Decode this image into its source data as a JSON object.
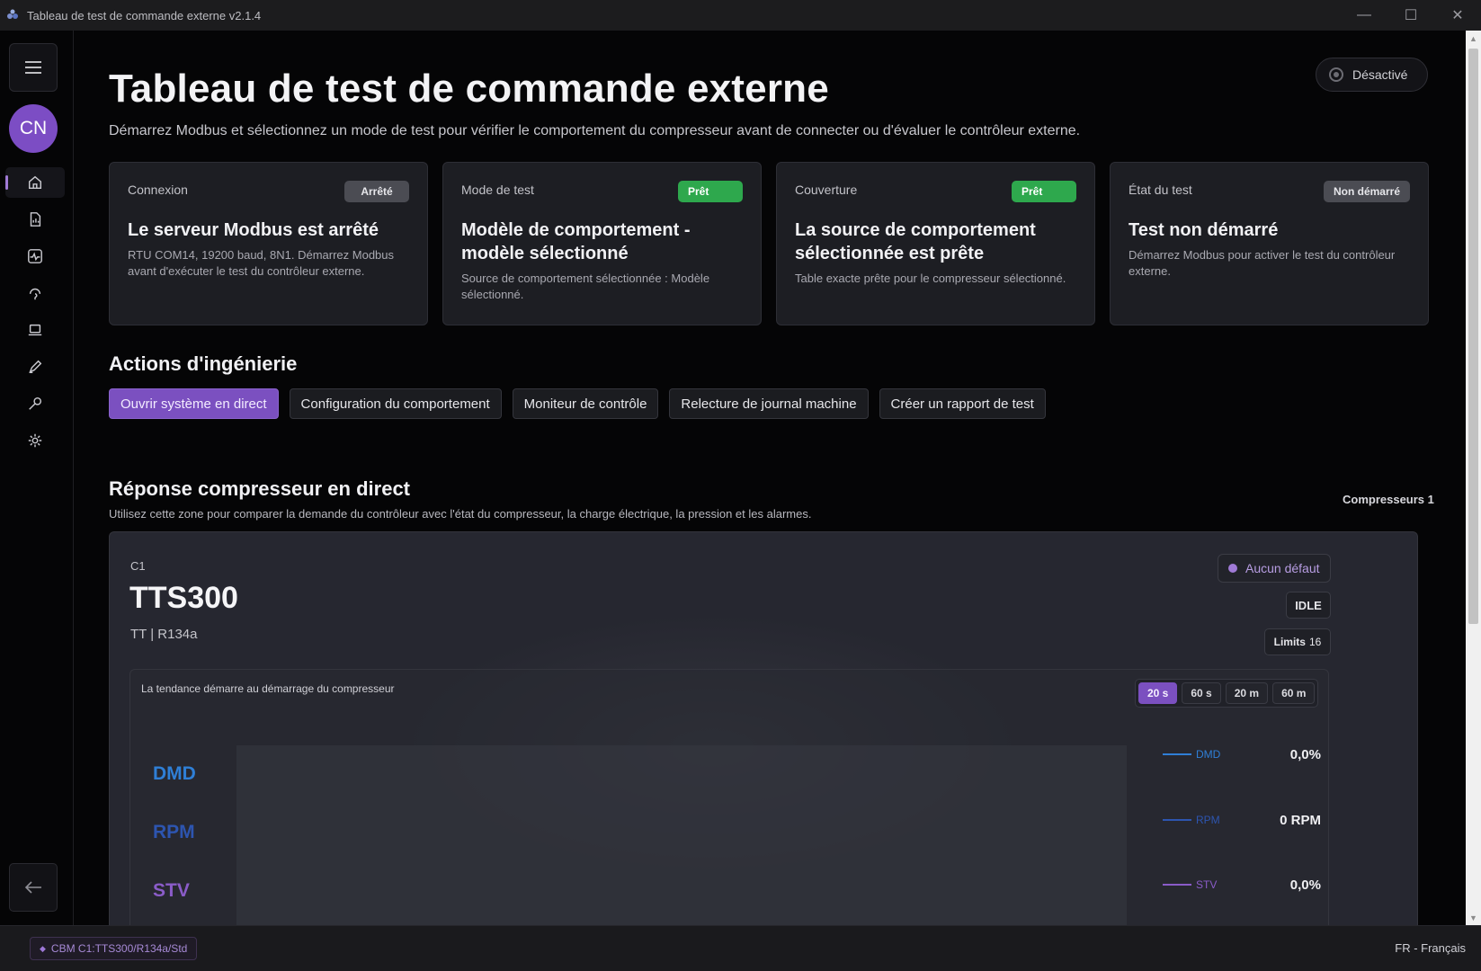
{
  "window": {
    "title": "Tableau de test de commande externe v2.1.4",
    "app_icon": "app-logo-icon"
  },
  "window_controls": {
    "minimize": "—",
    "maximize": "☐",
    "close": "✕"
  },
  "sidebar": {
    "avatar_initials": "CN",
    "items": [
      {
        "name": "home",
        "icon": "home-icon"
      },
      {
        "name": "reports",
        "icon": "report-icon"
      },
      {
        "name": "monitor",
        "icon": "activity-icon"
      },
      {
        "name": "support",
        "icon": "headset-icon"
      },
      {
        "name": "devices",
        "icon": "laptop-icon"
      },
      {
        "name": "edit",
        "icon": "pen-icon"
      },
      {
        "name": "tools",
        "icon": "wrench-icon"
      },
      {
        "name": "settings",
        "icon": "gear-icon"
      }
    ]
  },
  "header": {
    "title": "Tableau de test de commande externe",
    "subtitle": "Démarrez Modbus et sélectionnez un mode de test pour vérifier le comportement du compresseur avant de connecter ou d'évaluer le contrôleur externe.",
    "toggle_label": "Désactivé"
  },
  "cards": [
    {
      "label": "Connexion",
      "badge": "Arrêté",
      "badge_kind": "grey",
      "heading": "Le serveur Modbus est arrêté",
      "body": "RTU COM14, 19200 baud, 8N1. Démarrez Modbus avant d'exécuter le test du contrôleur externe."
    },
    {
      "label": "Mode de test",
      "badge": "Prêt",
      "badge_kind": "green",
      "heading": "Modèle de comportement - modèle sélectionné",
      "body": "Source de comportement sélectionnée : Modèle sélectionné."
    },
    {
      "label": "Couverture",
      "badge": "Prêt",
      "badge_kind": "green",
      "heading": "La source de comportement sélectionnée est prête",
      "body": "Table exacte prête pour le compresseur sélectionné."
    },
    {
      "label": "État du test",
      "badge": "Non démarré",
      "badge_kind": "grey",
      "heading": "Test non démarré",
      "body": "Démarrez Modbus pour activer le test du contrôleur externe."
    }
  ],
  "actions": {
    "title": "Actions d'ingénierie",
    "buttons": [
      "Ouvrir système en direct",
      "Configuration du comportement",
      "Moniteur de contrôle",
      "Relecture de journal machine",
      "Créer un rapport de test"
    ]
  },
  "live": {
    "title": "Réponse compresseur en direct",
    "subtitle": "Utilisez cette zone pour comparer la demande du contrôleur avec l'état du compresseur, la charge électrique, la pression et les alarmes.",
    "compressor_count": "Compresseurs 1"
  },
  "compressor": {
    "id": "C1",
    "model": "TTS300",
    "meta": "TT  |  R134a",
    "fault_status": "Aucun défaut",
    "state": "IDLE",
    "limits_label": "Limits",
    "limits_value": "16"
  },
  "trend": {
    "title": "La tendance démarre au démarrage du compresseur",
    "ranges": [
      "20 s",
      "60 s",
      "20 m",
      "60 m"
    ],
    "selected_range": "20 s",
    "series": [
      {
        "tag": "DMD",
        "legend": "DMD",
        "value": "0,0%",
        "color": "#2f7fd6"
      },
      {
        "tag": "RPM",
        "legend": "RPM",
        "value": "0 RPM",
        "color": "#2d55b0"
      },
      {
        "tag": "STV",
        "legend": "STV",
        "value": "0,0%",
        "color": "#8a5cc8"
      }
    ]
  },
  "statusbar": {
    "chip": "CBM C1:TTS300/R134a/Std",
    "language": "FR - Français"
  }
}
